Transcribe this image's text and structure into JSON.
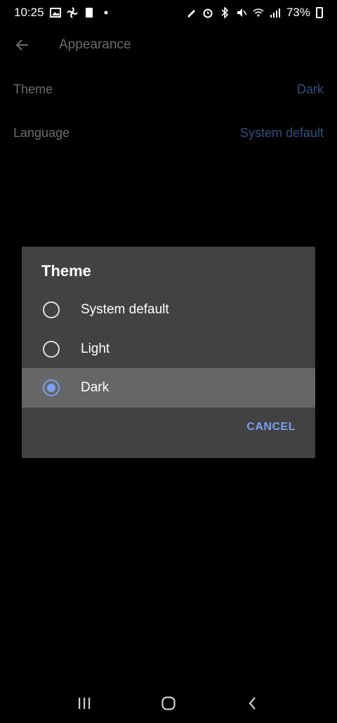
{
  "status_bar": {
    "time": "10:25",
    "battery": "73%"
  },
  "app_bar": {
    "title": "Appearance"
  },
  "settings": [
    {
      "label": "Theme",
      "value": "Dark"
    },
    {
      "label": "Language",
      "value": "System default"
    }
  ],
  "dialog": {
    "title": "Theme",
    "options": [
      {
        "label": "System default",
        "selected": false
      },
      {
        "label": "Light",
        "selected": false
      },
      {
        "label": "Dark",
        "selected": true
      }
    ],
    "cancel_label": "CANCEL"
  },
  "colors": {
    "accent": "#7aa0f0",
    "dialog_bg": "#424242",
    "selected_row": "#666666",
    "background": "#000000"
  },
  "icons": {
    "back": "arrow-left-icon",
    "nav_recents": "recents-icon",
    "nav_home": "home-icon",
    "nav_back": "chevron-left-icon"
  }
}
